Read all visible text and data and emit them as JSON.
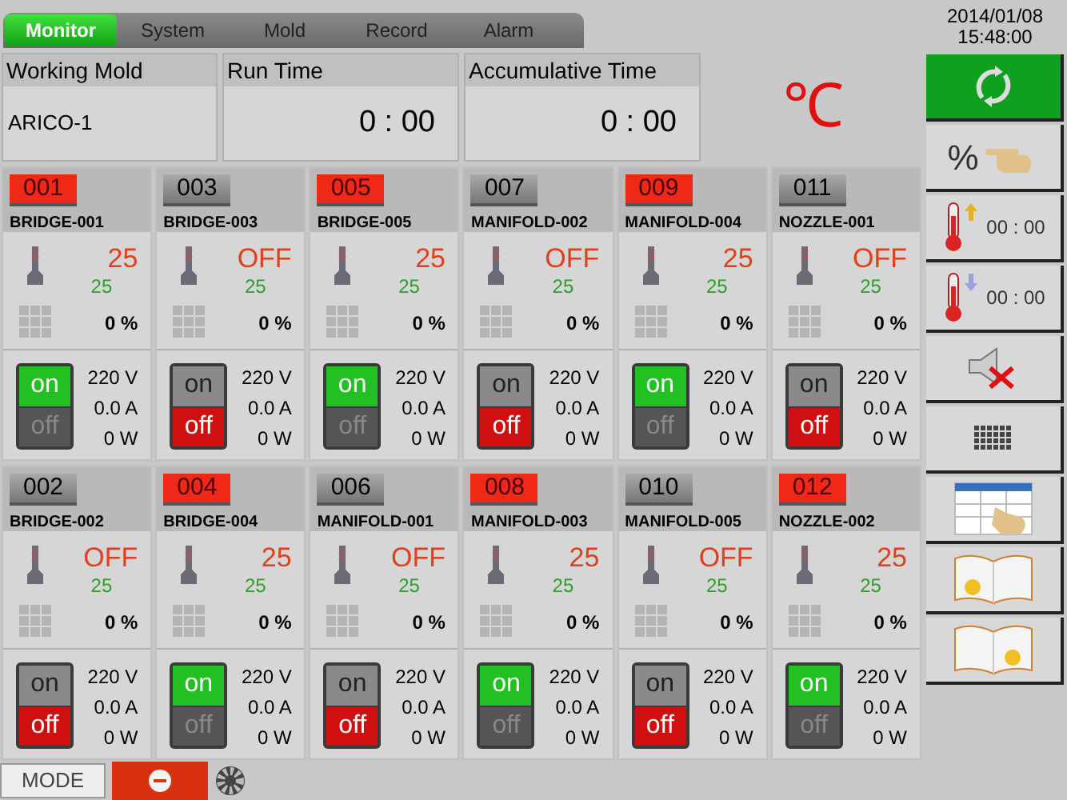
{
  "tabs": [
    {
      "label": "Monitor",
      "selected": true
    },
    {
      "label": "System",
      "selected": false
    },
    {
      "label": "Mold",
      "selected": false
    },
    {
      "label": "Record",
      "selected": false
    },
    {
      "label": "Alarm",
      "selected": false
    }
  ],
  "datetime": {
    "date": "2014/01/08",
    "time": "15:48:00"
  },
  "info": [
    {
      "label": "Working Mold",
      "value": "ARICO-1",
      "kind": "name"
    },
    {
      "label": "Run Time",
      "value": "0 : 00",
      "kind": "timer"
    },
    {
      "label": "Accumulative Time",
      "value": "0 : 00",
      "kind": "timer"
    }
  ],
  "unit": "℃",
  "zones": [
    {
      "number": "001",
      "name": "BRIDGE-001",
      "on_label": "on",
      "off_label": "off",
      "on": true,
      "temp": "25",
      "setpoint": "25",
      "output": "0 %",
      "voltage": "220 V",
      "current": "0.0 A",
      "power": "0 W"
    },
    {
      "number": "003",
      "name": "BRIDGE-003",
      "on_label": "on",
      "off_label": "off",
      "on": false,
      "temp": "OFF",
      "setpoint": "25",
      "output": "0 %",
      "voltage": "220 V",
      "current": "0.0 A",
      "power": "0 W"
    },
    {
      "number": "005",
      "name": "BRIDGE-005",
      "on_label": "on",
      "off_label": "off",
      "on": true,
      "temp": "25",
      "setpoint": "25",
      "output": "0 %",
      "voltage": "220 V",
      "current": "0.0 A",
      "power": "0 W"
    },
    {
      "number": "007",
      "name": "MANIFOLD-002",
      "on_label": "on",
      "off_label": "off",
      "on": false,
      "temp": "OFF",
      "setpoint": "25",
      "output": "0 %",
      "voltage": "220 V",
      "current": "0.0 A",
      "power": "0 W"
    },
    {
      "number": "009",
      "name": "MANIFOLD-004",
      "on_label": "on",
      "off_label": "off",
      "on": true,
      "temp": "25",
      "setpoint": "25",
      "output": "0 %",
      "voltage": "220 V",
      "current": "0.0 A",
      "power": "0 W"
    },
    {
      "number": "011",
      "name": "NOZZLE-001",
      "on_label": "on",
      "off_label": "off",
      "on": false,
      "temp": "OFF",
      "setpoint": "25",
      "output": "0 %",
      "voltage": "220 V",
      "current": "0.0 A",
      "power": "0 W"
    },
    {
      "number": "002",
      "name": "BRIDGE-002",
      "on_label": "on",
      "off_label": "off",
      "on": false,
      "temp": "OFF",
      "setpoint": "25",
      "output": "0 %",
      "voltage": "220 V",
      "current": "0.0 A",
      "power": "0 W"
    },
    {
      "number": "004",
      "name": "BRIDGE-004",
      "on_label": "on",
      "off_label": "off",
      "on": true,
      "temp": "25",
      "setpoint": "25",
      "output": "0 %",
      "voltage": "220 V",
      "current": "0.0 A",
      "power": "0 W"
    },
    {
      "number": "006",
      "name": "MANIFOLD-001",
      "on_label": "on",
      "off_label": "off",
      "on": false,
      "temp": "OFF",
      "setpoint": "25",
      "output": "0 %",
      "voltage": "220 V",
      "current": "0.0 A",
      "power": "0 W"
    },
    {
      "number": "008",
      "name": "MANIFOLD-003",
      "on_label": "on",
      "off_label": "off",
      "on": true,
      "temp": "25",
      "setpoint": "25",
      "output": "0 %",
      "voltage": "220 V",
      "current": "0.0 A",
      "power": "0 W"
    },
    {
      "number": "010",
      "name": "MANIFOLD-005",
      "on_label": "on",
      "off_label": "off",
      "on": false,
      "temp": "OFF",
      "setpoint": "25",
      "output": "0 %",
      "voltage": "220 V",
      "current": "0.0 A",
      "power": "0 W"
    },
    {
      "number": "012",
      "name": "NOZZLE-002",
      "on_label": "on",
      "off_label": "off",
      "on": true,
      "temp": "25",
      "setpoint": "25",
      "output": "0 %",
      "voltage": "220 V",
      "current": "0.0 A",
      "power": "0 W"
    }
  ],
  "side_buttons": [
    {
      "kind": "refresh",
      "active": true
    },
    {
      "kind": "percent",
      "text": "%",
      "active": false
    },
    {
      "kind": "heat-up",
      "text": "00 : 00",
      "active": false
    },
    {
      "kind": "cool-down",
      "text": "00 : 00",
      "active": false
    },
    {
      "kind": "mute",
      "active": false
    },
    {
      "kind": "keypad",
      "active": false
    },
    {
      "kind": "table",
      "active": false
    },
    {
      "kind": "book-left",
      "active": false
    },
    {
      "kind": "book-right",
      "active": false
    }
  ],
  "bottom": {
    "mode": "MODE"
  }
}
